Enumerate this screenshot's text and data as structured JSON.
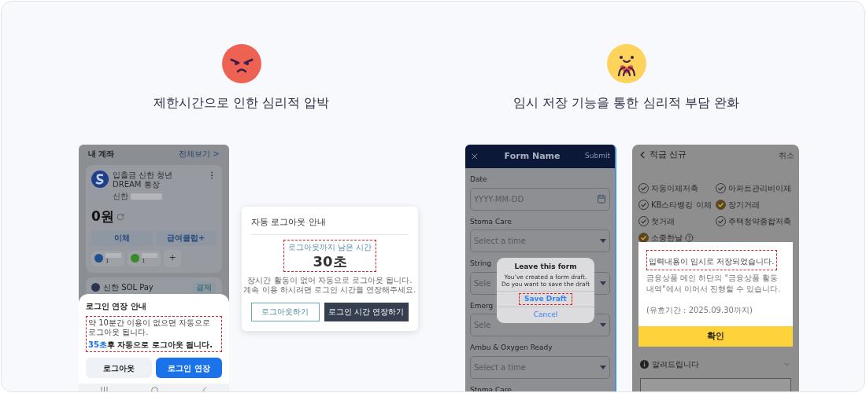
{
  "left": {
    "title": "제한시간으로 인한 심리적 압박",
    "phone": {
      "header": {
        "title": "내 계좌",
        "link": "전체보기 >"
      },
      "account": {
        "name": "입출금 신한 청년 DREAM 통장",
        "bank": "신한",
        "balance": "0원",
        "buttons": [
          "이체",
          "급여클럽+"
        ],
        "add": "+",
        "assets": [
          {
            "count": "1",
            "color": "#1f4f8f"
          },
          {
            "count": "1",
            "color": "#3a8a2a"
          }
        ]
      },
      "pay": {
        "name": "신한 SOL Pay",
        "button": "결제"
      },
      "sheet": {
        "title": "로그인 연장 안내",
        "message": "약 10분간 이용이 없으면 자동으로 로그아웃 됩니다.",
        "countdown": "35초",
        "countdown_text": "후 자동으로 로그아웃 됩니다.",
        "buttons": [
          {
            "label": "로그아웃",
            "kind": "secondary"
          },
          {
            "label": "로그인 연장",
            "kind": "primary"
          }
        ]
      }
    },
    "dialog": {
      "title": "자동 로그아웃 안내",
      "timer_label": "로그아웃까지 남은 시간",
      "timer": "30초",
      "lines": [
        "장시간 활동이 없어 자동으로 로그아웃 됩니다.",
        "계속 이용 하시려면 로그인 시간을 연장해주세요."
      ],
      "buttons": [
        {
          "label": "로그아웃하기",
          "kind": "outline"
        },
        {
          "label": "로그인 시간 연장하기",
          "kind": "solid"
        }
      ]
    }
  },
  "right": {
    "title": "임시 저장 기능을 통한 심리적 부담 완화",
    "form_phone": {
      "header": {
        "title": "Form Name",
        "action": "Submit"
      },
      "fields": [
        {
          "label": "Date",
          "kind": "date",
          "placeholder": "YYYY-MM-DD"
        },
        {
          "label": "Stoma Care",
          "kind": "select",
          "placeholder": "Select a time"
        },
        {
          "label": "String",
          "kind": "select",
          "placeholder": "Sele"
        },
        {
          "label": "Emerg",
          "kind": "select",
          "placeholder": "Sele"
        },
        {
          "label": "Ambu & Oxygen Ready",
          "kind": "select",
          "placeholder": "Select a time"
        },
        {
          "label": "Stoma Care"
        }
      ],
      "alert": {
        "title": "Leave this form",
        "message": "You’ve created a form draft. Do you want to save the draft",
        "actions": [
          "Save Draft",
          "Cancel"
        ]
      }
    },
    "savings_phone": {
      "header": {
        "title": "적금 신규",
        "action": "취소"
      },
      "options": [
        {
          "label": "자동이체저축",
          "checked": false,
          "help": false
        },
        {
          "label": "아파트관리비이체",
          "checked": false,
          "help": false
        },
        {
          "label": "KB스타뱅킹 이체",
          "checked": false,
          "help": false
        },
        {
          "label": "장기거래",
          "checked": true,
          "help": false
        },
        {
          "label": "첫거래",
          "checked": false,
          "help": false
        },
        {
          "label": "주택청약종합저축",
          "checked": false,
          "help": false
        },
        {
          "label": "소중한날",
          "checked": true,
          "help": true
        }
      ],
      "modal": {
        "highlight": "입력내용이 임시로 저장되었습니다.",
        "message": "금융상품 메인 하단의 \"금융상품 활동내역\"에서 이어서 진행할 수 있습니다.",
        "validity": "(유효기간 : 2025.09.30까지)",
        "button": "확인"
      },
      "notice": "알려드립니다"
    }
  }
}
